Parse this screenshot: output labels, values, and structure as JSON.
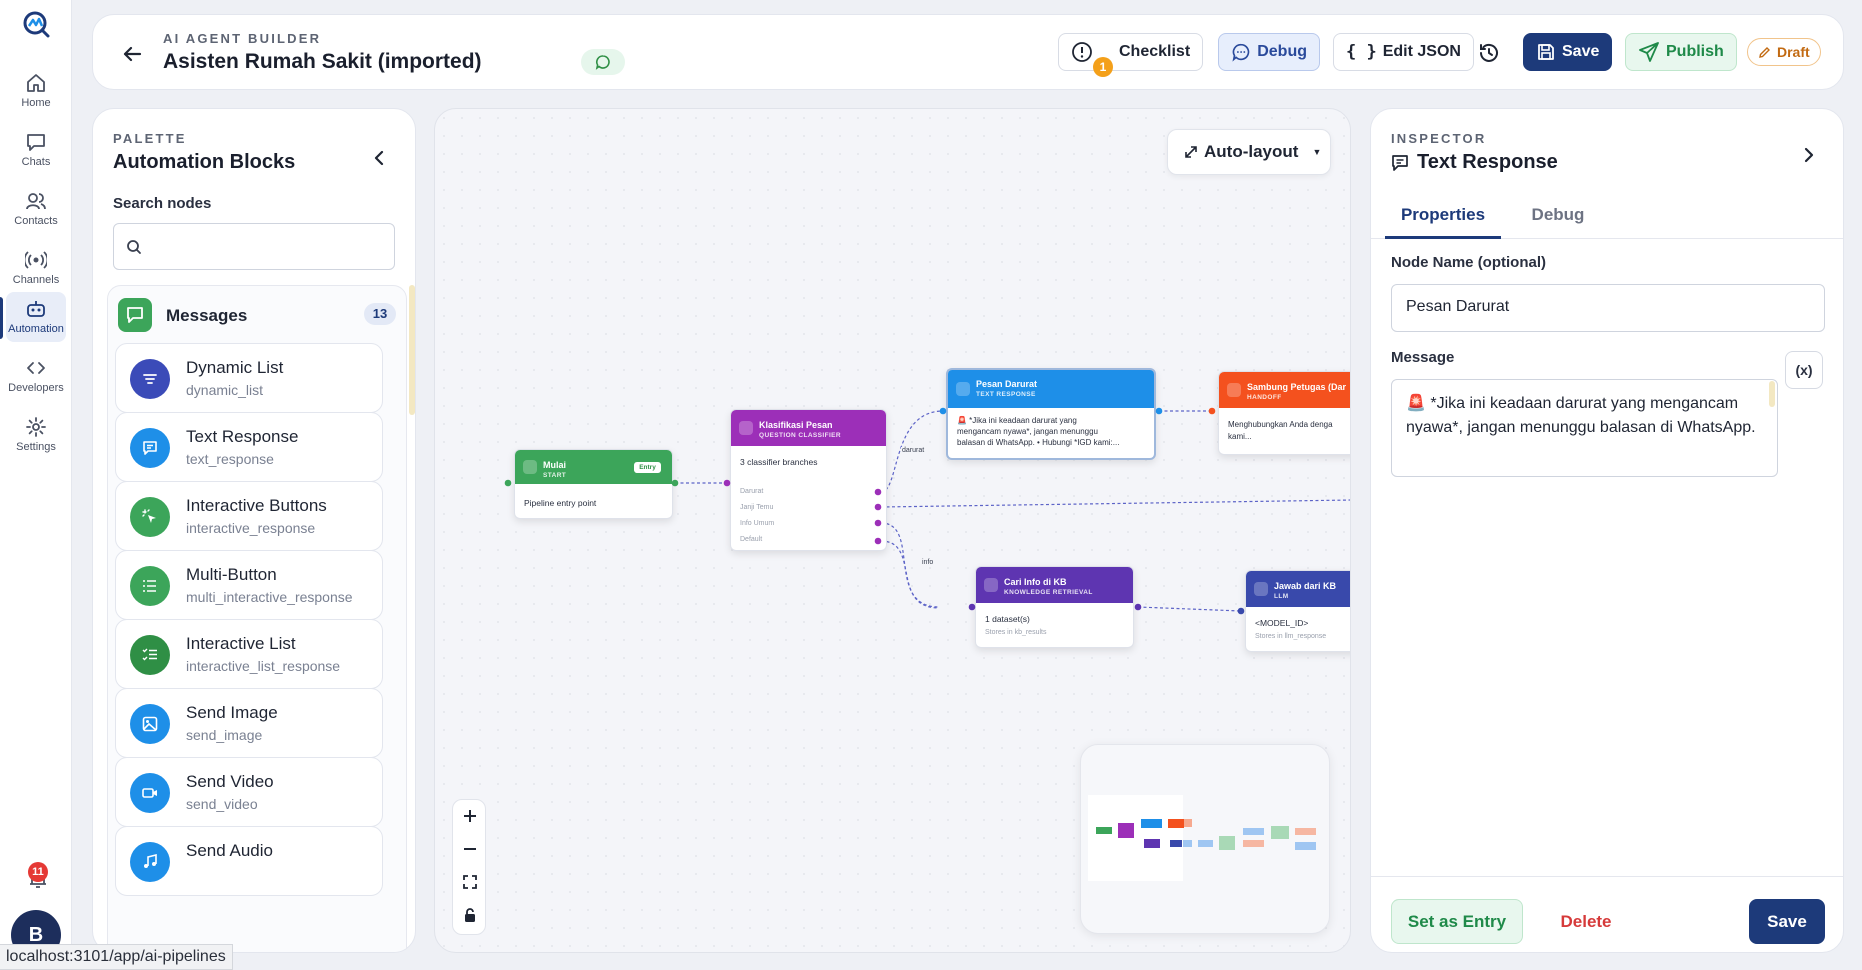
{
  "rail": {
    "items": [
      {
        "label": "Home",
        "icon": "home-icon"
      },
      {
        "label": "Chats",
        "icon": "chat-icon"
      },
      {
        "label": "Contacts",
        "icon": "contacts-icon"
      },
      {
        "label": "Channels",
        "icon": "broadcast-icon"
      },
      {
        "label": "Automation",
        "icon": "robot-icon",
        "active": true
      },
      {
        "label": "Developers",
        "icon": "code-icon"
      },
      {
        "label": "Settings",
        "icon": "gear-icon"
      }
    ],
    "notification_count": "11",
    "avatar_initial": "B"
  },
  "header": {
    "subtitle": "AI AGENT BUILDER",
    "title": "Asisten Rumah Sakit (imported)",
    "checklist_label": "Checklist",
    "checklist_badge": "1",
    "debug_label": "Debug",
    "edit_json_label": "Edit JSON",
    "save_label": "Save",
    "publish_label": "Publish",
    "draft_label": "Draft"
  },
  "palette": {
    "subtitle": "PALETTE",
    "title": "Automation Blocks",
    "search_label": "Search nodes",
    "search_value": "",
    "group": {
      "title": "Messages",
      "count": "13"
    },
    "items": [
      {
        "name": "Dynamic List",
        "id": "dynamic_list",
        "color": "#3b4bb8",
        "icon": "list-filter-icon"
      },
      {
        "name": "Text Response",
        "id": "text_response",
        "color": "#1e8fe8",
        "icon": "text-message-icon"
      },
      {
        "name": "Interactive Buttons",
        "id": "interactive_response",
        "color": "#3ca55a",
        "icon": "cursor-click-icon"
      },
      {
        "name": "Multi-Button",
        "id": "multi_interactive_response",
        "color": "#3ca55a",
        "icon": "list-icon"
      },
      {
        "name": "Interactive List",
        "id": "interactive_list_response",
        "color": "#2f8f45",
        "icon": "checklist-icon"
      },
      {
        "name": "Send Image",
        "id": "send_image",
        "color": "#1e8fe8",
        "icon": "image-icon"
      },
      {
        "name": "Send Video",
        "id": "send_video",
        "color": "#1e8fe8",
        "icon": "video-icon"
      },
      {
        "name": "Send Audio",
        "id": "",
        "color": "#1e8fe8",
        "icon": "audio-icon"
      }
    ]
  },
  "canvas": {
    "autolayout_label": "Auto-layout",
    "nodes": {
      "start": {
        "title": "Mulai",
        "type": "START",
        "badge": "Entry",
        "body": "Pipeline entry point",
        "color": "#3ca55a"
      },
      "classifier": {
        "title": "Klasifikasi Pesan",
        "type": "QUESTION CLASSIFIER",
        "summary": "3 classifier branches",
        "branches": [
          "Darurat",
          "Janji Temu",
          "Info Umum",
          "Default"
        ],
        "color": "#9c2fb8"
      },
      "darurat": {
        "title": "Pesan Darurat",
        "type": "TEXT RESPONSE",
        "body_lines": [
          "🚨 *Jika ini keadaan darurat yang",
          "mengancam nyawa*, jangan menunggu",
          "balasan di WhatsApp. • Hubungi *IGD kami:..."
        ],
        "color": "#1e8fe8"
      },
      "handoff": {
        "title": "Sambung Petugas (Dar",
        "type": "HANDOFF",
        "body_lines": [
          "Menghubungkan Anda denga",
          "kami..."
        ],
        "color": "#f4511e"
      },
      "kb": {
        "title": "Cari Info di KB",
        "type": "KNOWLEDGE RETRIEVAL",
        "body": "1 dataset(s)",
        "note": "Stores in kb_results",
        "color": "#5e35b1"
      },
      "llm": {
        "title": "Jawab dari KB",
        "type": "LLM",
        "body": "<MODEL_ID>",
        "note": "Stores in llm_response",
        "color": "#3949ab"
      }
    },
    "edge_labels": {
      "darurat": "darurat",
      "info": "info"
    }
  },
  "inspector": {
    "subtitle": "INSPECTOR",
    "title": "Text Response",
    "tabs": [
      "Properties",
      "Debug"
    ],
    "node_name_label": "Node Name (optional)",
    "node_name_value": "Pesan Darurat",
    "message_label": "Message",
    "variable_button": "(x)",
    "message_value": "🚨 *Jika ini keadaan darurat yang mengancam nyawa*, jangan menunggu balasan di WhatsApp.",
    "set_entry_label": "Set as Entry",
    "delete_label": "Delete",
    "save_label": "Save"
  },
  "status_url": "localhost:3101/app/ai-pipelines"
}
